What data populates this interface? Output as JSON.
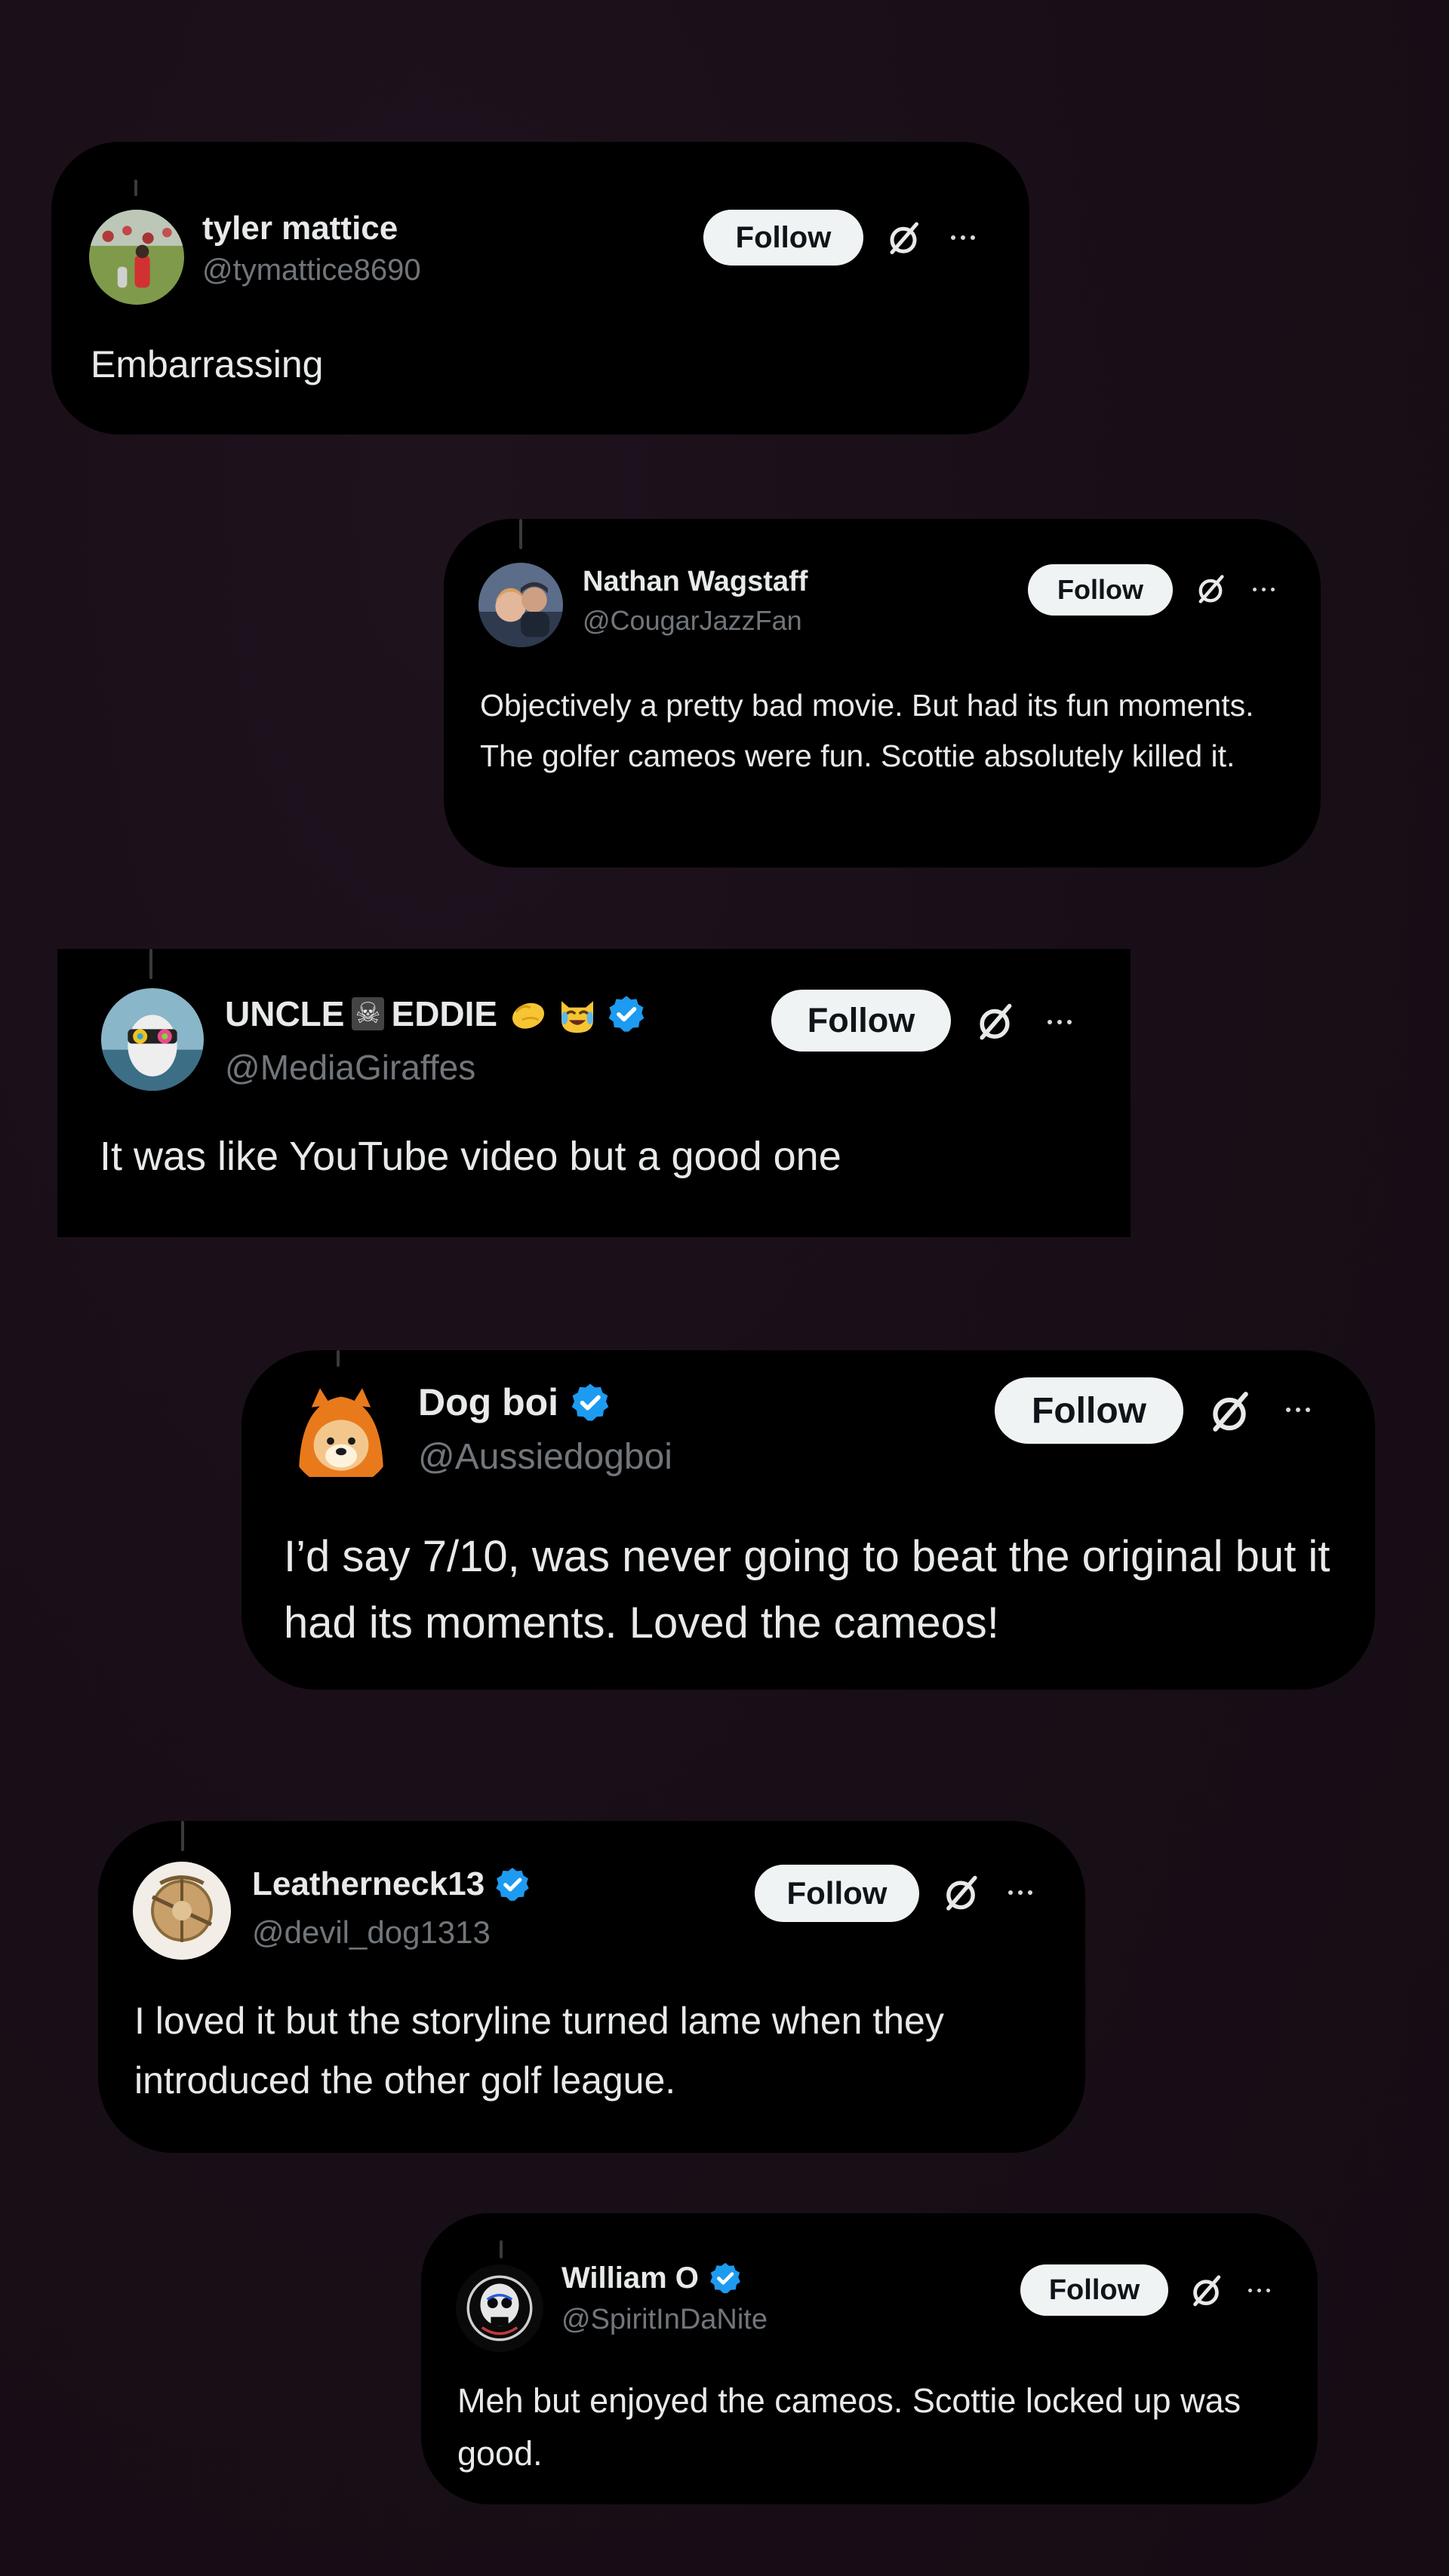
{
  "replies": [
    {
      "name": "tyler mattice",
      "handle": "@tymattice8690",
      "verified": false,
      "follow_label": "Follow",
      "text": "Embarrassing"
    },
    {
      "name": "Nathan Wagstaff",
      "handle": "@CougarJazzFan",
      "verified": false,
      "follow_label": "Follow",
      "text": "Objectively a pretty bad movie. But had its fun moments. The golfer cameos were fun. Scottie absolutely killed it."
    },
    {
      "name_part1": "UNCLE",
      "name_part2": "EDDIE",
      "name_emoji_1": "☠",
      "name_emoji_2": "👊",
      "name_emoji_3": "😹",
      "handle": "@MediaGiraffes",
      "verified": true,
      "follow_label": "Follow",
      "text": "It was like YouTube video but a good one"
    },
    {
      "name": "Dog boi",
      "handle": "@Aussiedogboi",
      "verified": true,
      "follow_label": "Follow",
      "text": "I’d say 7/10, was never going to beat the original but it had its moments. Loved the cameos!"
    },
    {
      "name": "Leatherneck13",
      "handle": "@devil_dog1313",
      "verified": true,
      "follow_label": "Follow",
      "text": "I loved it but the storyline turned lame when they introduced the other golf league."
    },
    {
      "name": "William O",
      "handle": "@SpiritInDaNite",
      "verified": true,
      "follow_label": "Follow",
      "text": "Meh but enjoyed the cameos. Scottie locked up was good."
    }
  ],
  "icons": {
    "verified": "verified-badge-icon",
    "grok": "grok-icon",
    "more": "more-options-icon"
  },
  "colors": {
    "background": "#1a1019",
    "card": "#000000",
    "text": "#e7e9ea",
    "handle": "#71767b",
    "verified": "#1d9bf0",
    "follow_bg": "#eff3f4"
  }
}
